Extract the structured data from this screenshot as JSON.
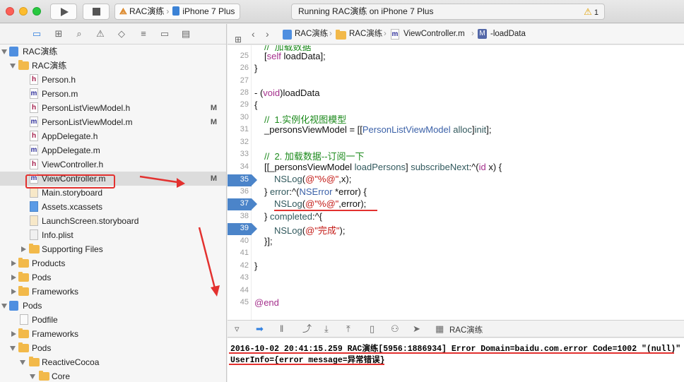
{
  "toolbar": {
    "scheme_name": "RAC演练",
    "device": "iPhone 7 Plus",
    "activity_text": "Running RAC演练 on iPhone 7 Plus",
    "warning_count": "1"
  },
  "navigator": {
    "tabs": [
      "folder-icon",
      "hierarchy-icon",
      "search-icon",
      "warning-icon",
      "test-icon",
      "debug-icon",
      "breakpoint-icon",
      "log-icon"
    ],
    "items": [
      {
        "label": "RAC演练",
        "badge": ""
      },
      {
        "label": "RAC演练",
        "badge": ""
      },
      {
        "label": "Person.h",
        "badge": ""
      },
      {
        "label": "Person.m",
        "badge": ""
      },
      {
        "label": "PersonListViewModel.h",
        "badge": "M"
      },
      {
        "label": "PersonListViewModel.m",
        "badge": "M"
      },
      {
        "label": "AppDelegate.h",
        "badge": ""
      },
      {
        "label": "AppDelegate.m",
        "badge": ""
      },
      {
        "label": "ViewController.h",
        "badge": ""
      },
      {
        "label": "ViewController.m",
        "badge": "M"
      },
      {
        "label": "Main.storyboard",
        "badge": ""
      },
      {
        "label": "Assets.xcassets",
        "badge": ""
      },
      {
        "label": "LaunchScreen.storyboard",
        "badge": ""
      },
      {
        "label": "Info.plist",
        "badge": ""
      },
      {
        "label": "Supporting Files",
        "badge": ""
      },
      {
        "label": "Products",
        "badge": ""
      },
      {
        "label": "Pods",
        "badge": ""
      },
      {
        "label": "Frameworks",
        "badge": ""
      },
      {
        "label": "Pods",
        "badge": ""
      },
      {
        "label": "Podfile",
        "badge": ""
      },
      {
        "label": "Frameworks",
        "badge": ""
      },
      {
        "label": "Pods",
        "badge": ""
      },
      {
        "label": "ReactiveCocoa",
        "badge": ""
      },
      {
        "label": "Core",
        "badge": ""
      }
    ]
  },
  "jumpbar": {
    "crumbs": [
      "RAC演练",
      "RAC演练",
      "ViewController.m",
      "-loadData"
    ]
  },
  "editor": {
    "line_numbers": [
      "25",
      "26",
      "27",
      "28",
      "29",
      "30",
      "31",
      "32",
      "33",
      "34",
      "35",
      "36",
      "37",
      "38",
      "39",
      "40",
      "41",
      "42",
      "43",
      "44",
      "45"
    ],
    "breakpoint_lines": [
      "35",
      "37",
      "39"
    ],
    "top_fragment": "//  加载数据"
  },
  "debugbar": {
    "target_label": "RAC演练"
  },
  "console": {
    "line1": "2016-10-02 20:41:15.259 RAC演练[5956:1886934] Error Domain=baidu.com.error Code=1002 \"(null)\"",
    "line2": "UserInfo={error message=异常错误}"
  }
}
